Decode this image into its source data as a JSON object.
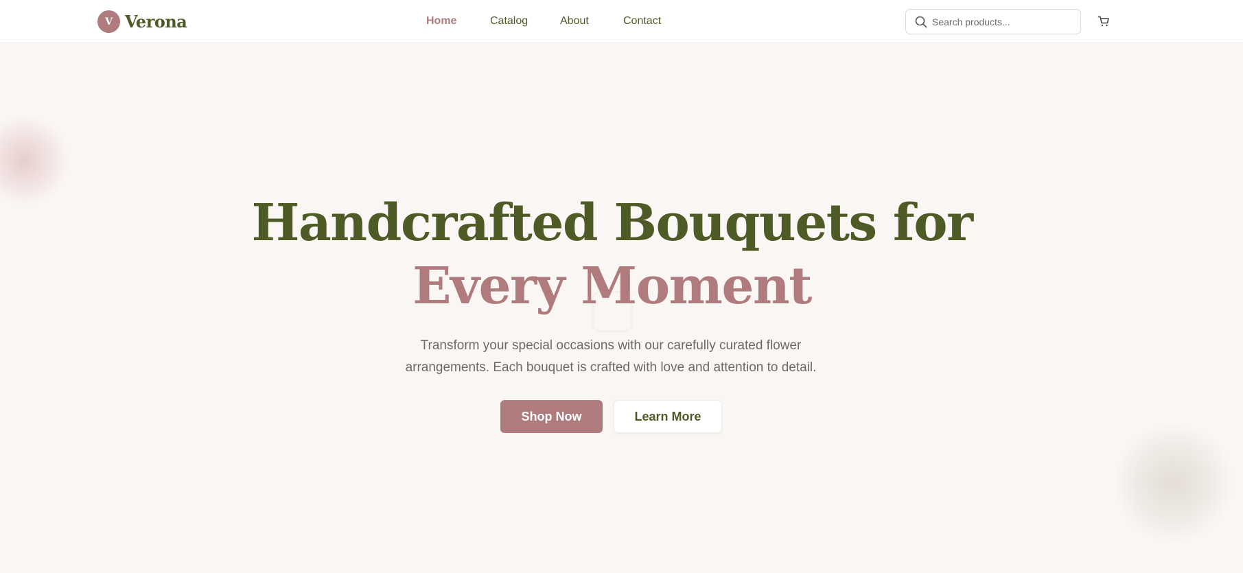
{
  "brand": {
    "badge": "V",
    "name": "Verona"
  },
  "nav": {
    "items": [
      {
        "label": "Home",
        "active": true
      },
      {
        "label": "Catalog",
        "active": false
      },
      {
        "label": "About",
        "active": false
      },
      {
        "label": "Contact",
        "active": false
      }
    ]
  },
  "search": {
    "placeholder": "Search products...",
    "value": "",
    "icon": "search-icon"
  },
  "cart": {
    "icon": "cart-icon"
  },
  "hero": {
    "title_line1": "Handcrafted Bouquets for",
    "title_line2": "Every Moment",
    "subtitle": "Transform your special occasions with our carefully curated flower arrangements. Each bouquet is crafted with love and attention to detail.",
    "primary_button": "Shop Now",
    "secondary_button": "Learn More"
  },
  "colors": {
    "brand_green": "#4f5b27",
    "brand_rose": "#b07b7d",
    "background": "#faf6f4"
  }
}
